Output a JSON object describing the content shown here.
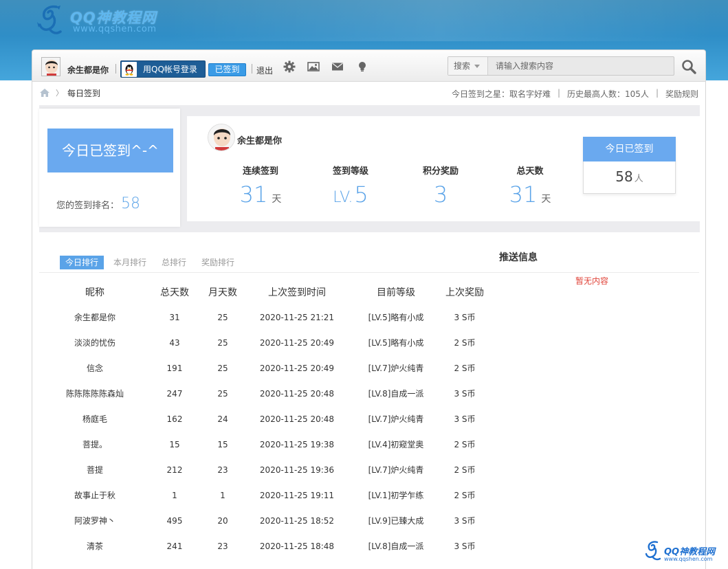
{
  "site": {
    "title": "QQ神教程网",
    "url": "www.qqshen.com",
    "corner_title": "QQ神教程网",
    "corner_url": "www.qqshen.com"
  },
  "toolbar": {
    "username": "余生都是你",
    "qq_login": "用QQ帐号登录",
    "signed": "已签到",
    "logout": "退出",
    "icons": [
      "gear-icon",
      "image-icon",
      "mail-icon",
      "lightbulb-icon"
    ],
    "search_type": "搜索",
    "search_placeholder": "请输入搜索内容"
  },
  "breadcrumb": {
    "current": "每日签到",
    "star_label": "今日签到之星：",
    "star_name": "取名字好难",
    "max_label": "历史最高人数：",
    "max_value": "105人",
    "rules": "奖励规则"
  },
  "checkin": {
    "button": "今日已签到^-^",
    "rank_label": "您的签到排名：",
    "rank_value": "58",
    "username": "余生都是你",
    "stats": [
      {
        "label": "连续签到",
        "value": "31",
        "unit": "天",
        "prefix": ""
      },
      {
        "label": "签到等级",
        "value": "5",
        "unit": "",
        "prefix": "LV."
      },
      {
        "label": "积分奖励",
        "value": "3",
        "unit": "",
        "prefix": ""
      },
      {
        "label": "总天数",
        "value": "31",
        "unit": "天",
        "prefix": ""
      }
    ],
    "today_title": "今日已签到",
    "today_count": "58",
    "today_unit": "人"
  },
  "tabs": [
    "今日排行",
    "本月排行",
    "总排行",
    "奖励排行"
  ],
  "push": {
    "title": "推送信息",
    "empty": "暂无内容"
  },
  "table": {
    "headers": [
      "昵称",
      "总天数",
      "月天数",
      "上次签到时间",
      "目前等级",
      "上次奖励"
    ],
    "rows": [
      [
        "余生都是你",
        "31",
        "25",
        "2020-11-25 21:21",
        "[LV.5]略有小成",
        "3 S币"
      ],
      [
        "淡淡的忧伤",
        "43",
        "25",
        "2020-11-25 20:49",
        "[LV.5]略有小成",
        "2 S币"
      ],
      [
        "信念",
        "191",
        "25",
        "2020-11-25 20:49",
        "[LV.7]炉火纯青",
        "2 S币"
      ],
      [
        "陈陈陈陈陈森灿",
        "247",
        "25",
        "2020-11-25 20:48",
        "[LV.8]自成一派",
        "3 S币"
      ],
      [
        "杨庭毛",
        "162",
        "24",
        "2020-11-25 20:48",
        "[LV.7]炉火纯青",
        "3 S币"
      ],
      [
        "菩提。",
        "15",
        "15",
        "2020-11-25 19:38",
        "[LV.4]初窥堂奥",
        "2 S币"
      ],
      [
        "菩提",
        "212",
        "23",
        "2020-11-25 19:36",
        "[LV.7]炉火纯青",
        "2 S币"
      ],
      [
        "故事止于秋",
        "1",
        "1",
        "2020-11-25 19:11",
        "[LV.1]初学乍练",
        "2 S币"
      ],
      [
        "阿波罗神丶",
        "495",
        "20",
        "2020-11-25 18:52",
        "[LV.9]已臻大成",
        "3 S币"
      ],
      [
        "清茶",
        "241",
        "23",
        "2020-11-25 18:48",
        "[LV.8]自成一派",
        "3 S币"
      ]
    ]
  },
  "colors": {
    "accent": "#5aa3e8",
    "banner": "#2f8ec7",
    "empty_text": "#e0443a"
  }
}
